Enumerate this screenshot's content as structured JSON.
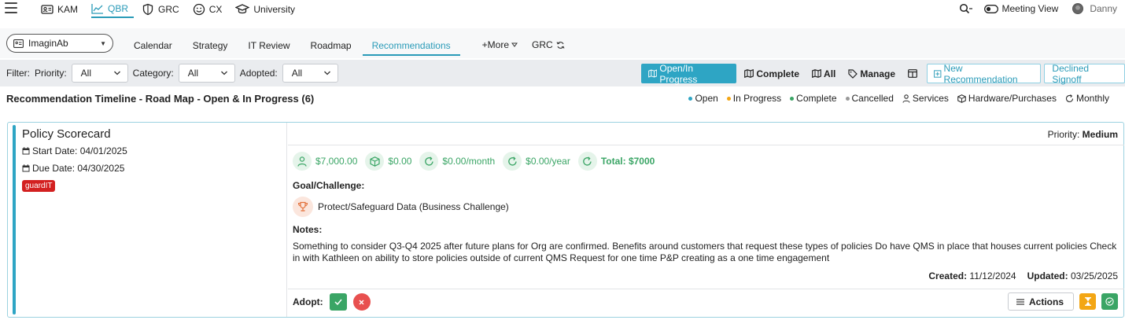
{
  "topnav": {
    "items": [
      {
        "label": "KAM"
      },
      {
        "label": "QBR"
      },
      {
        "label": "GRC"
      },
      {
        "label": "CX"
      },
      {
        "label": "University"
      }
    ],
    "meeting_view": "Meeting View",
    "user": "Danny"
  },
  "subnav": {
    "client": "ImaginAb",
    "tabs": [
      "Calendar",
      "Strategy",
      "IT Review",
      "Roadmap",
      "Recommendations"
    ],
    "more": "+More",
    "grc": "GRC"
  },
  "filters": {
    "label": "Filter:",
    "priority_label": "Priority:",
    "priority_value": "All",
    "category_label": "Category:",
    "category_value": "All",
    "adopted_label": "Adopted:",
    "adopted_value": "All",
    "buttons": {
      "open": "Open/In Progress",
      "complete": "Complete",
      "all": "All",
      "manage": "Manage",
      "new_rec": "New Recommendation",
      "declined": "Declined Signoff"
    }
  },
  "timeline": {
    "title": "Recommendation Timeline - Road Map - Open & In Progress (6)",
    "legend": [
      {
        "label": "Open",
        "color": "#2ea5c4"
      },
      {
        "label": "In Progress",
        "color": "#f3a614"
      },
      {
        "label": "Complete",
        "color": "#3aa565"
      },
      {
        "label": "Cancelled",
        "color": "#999999"
      },
      {
        "label": "Services"
      },
      {
        "label": "Hardware/Purchases"
      },
      {
        "label": "Monthly"
      }
    ]
  },
  "card": {
    "title": "Policy Scorecard",
    "start_date": "Start Date: 04/01/2025",
    "due_date": "Due Date: 04/30/2025",
    "tag": "guardIT",
    "priority_label": "Priority:",
    "priority_value": "Medium",
    "costs": [
      "$7,000.00",
      "$0.00",
      "$0.00/month",
      "$0.00/year",
      "Total: $7000"
    ],
    "goal_label": "Goal/Challenge:",
    "goal": "Protect/Safeguard Data (Business Challenge)",
    "notes_label": "Notes:",
    "notes": "Something to consider Q3-Q4 2025 after future plans for Org are confirmed. Benefits around customers that request these types of policies Do have QMS in place that houses current policies Check in with Kathleen on ability to store policies outside of current QMS Request for one time P&P creating as a one time engagement",
    "created_label": "Created:",
    "created": "11/12/2024",
    "updated_label": "Updated:",
    "updated": "03/25/2025",
    "adopt_label": "Adopt:",
    "actions_label": "Actions"
  }
}
